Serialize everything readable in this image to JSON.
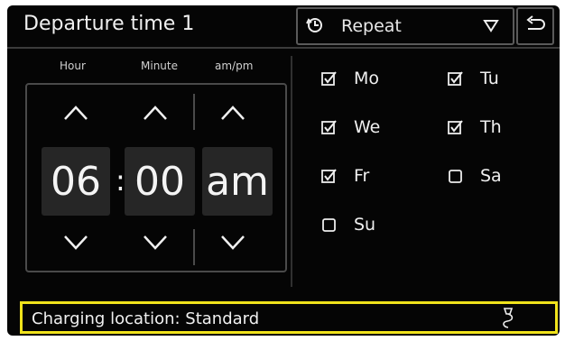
{
  "header": {
    "title": "Departure time 1",
    "repeat_label": "Repeat"
  },
  "time_picker": {
    "hour_label": "Hour",
    "minute_label": "Minute",
    "ampm_label": "am/pm",
    "hour": "06",
    "separator": ":",
    "minute": "00",
    "ampm": "am"
  },
  "days": [
    {
      "label": "Mo",
      "checked": true
    },
    {
      "label": "Tu",
      "checked": true
    },
    {
      "label": "We",
      "checked": true
    },
    {
      "label": "Th",
      "checked": true
    },
    {
      "label": "Fr",
      "checked": true
    },
    {
      "label": "Sa",
      "checked": false
    },
    {
      "label": "Su",
      "checked": false
    }
  ],
  "footer": {
    "charging_location": "Charging location: Standard"
  },
  "colors": {
    "background": "#050505",
    "highlight": "#f0e31b",
    "value_box": "#262626"
  }
}
